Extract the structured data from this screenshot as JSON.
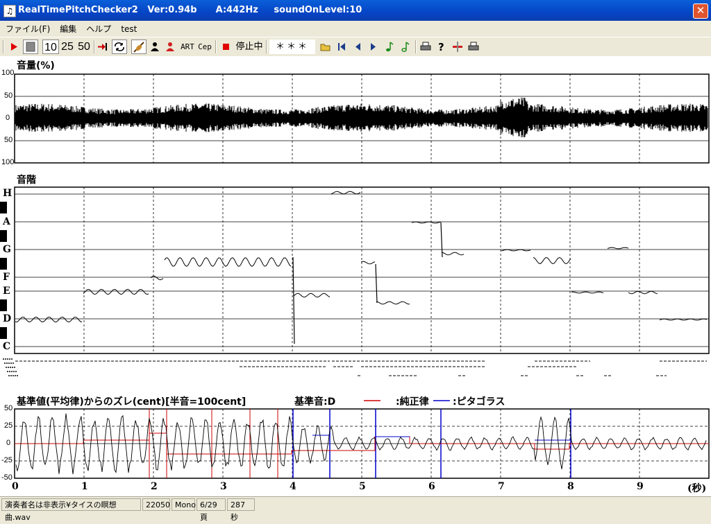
{
  "window": {
    "title": "RealTimePitchChecker2   Ver:0.94b      A:442Hz     soundOnLevel:10",
    "close": "✕"
  },
  "menu": [
    "ファイル(F)",
    "編集",
    "ヘルプ",
    "test"
  ],
  "toolbar": {
    "zoom": [
      "10",
      "25",
      "50"
    ],
    "art": "ART",
    "cep": "Cep",
    "status": "停止中",
    "stars": "＊＊＊"
  },
  "volume": {
    "title": "音量(%)",
    "yticks": [
      "100",
      "50",
      "0",
      "50",
      "100"
    ]
  },
  "scale": {
    "title": "音階",
    "notes": [
      "H",
      "A",
      "G",
      "F",
      "E",
      "D",
      "C"
    ]
  },
  "deviation": {
    "title": "基準値(平均律)からのズレ(cent)[半音=100cent]",
    "base_note": "基準音:D",
    "legend_just": ":純正律",
    "legend_pyth": ":ピタゴラス",
    "just_color": "#cc0000",
    "pyth_color": "#0000cc",
    "yticks": [
      "50",
      "25",
      "0",
      "-25",
      "-50"
    ],
    "xticks": [
      "0",
      "1",
      "2",
      "3",
      "4",
      "5",
      "6",
      "7",
      "8",
      "9"
    ],
    "xunit": "(秒)"
  },
  "status": {
    "file": "演奏者名は非表示¥タイスの瞑想曲.wav",
    "rate": "22050",
    "channels": "Mono",
    "page": "6/29頁",
    "length": "287秒"
  }
}
